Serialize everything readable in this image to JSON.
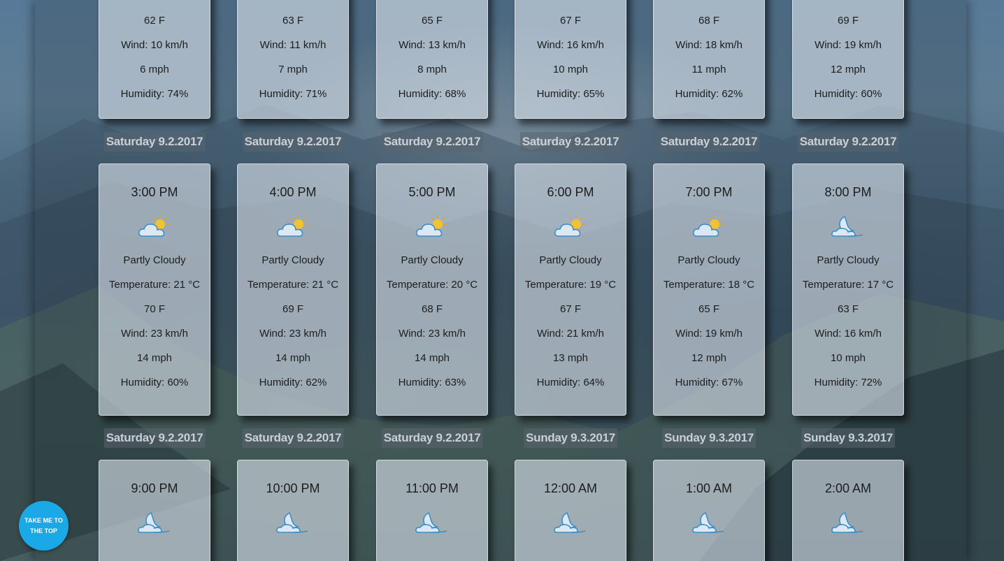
{
  "back_to_top": {
    "label": "TAKE ME TO THE TOP"
  },
  "rows": [
    {
      "cards": [
        {
          "temp_f": "62 F",
          "wind_kmh": "Wind: 10 km/h",
          "wind_mph": "6 mph",
          "humidity": "Humidity: 74%"
        },
        {
          "temp_f": "63 F",
          "wind_kmh": "Wind: 11 km/h",
          "wind_mph": "7 mph",
          "humidity": "Humidity: 71%"
        },
        {
          "temp_f": "65 F",
          "wind_kmh": "Wind: 13 km/h",
          "wind_mph": "8 mph",
          "humidity": "Humidity: 68%"
        },
        {
          "temp_f": "67 F",
          "wind_kmh": "Wind: 16 km/h",
          "wind_mph": "10 mph",
          "humidity": "Humidity: 65%"
        },
        {
          "temp_f": "68 F",
          "wind_kmh": "Wind: 18 km/h",
          "wind_mph": "11 mph",
          "humidity": "Humidity: 62%"
        },
        {
          "temp_f": "69 F",
          "wind_kmh": "Wind: 19 km/h",
          "wind_mph": "12 mph",
          "humidity": "Humidity: 60%"
        }
      ]
    },
    {
      "dates": [
        "Saturday 9.2.2017",
        "Saturday 9.2.2017",
        "Saturday 9.2.2017",
        "Saturday 9.2.2017",
        "Saturday 9.2.2017",
        "Saturday 9.2.2017"
      ],
      "cards": [
        {
          "time": "3:00 PM",
          "icon": "partly-cloudy-day-icon",
          "condition": "Partly Cloudy",
          "temp_c": "Temperature: 21 °C",
          "temp_f": "70 F",
          "wind_kmh": "Wind: 23 km/h",
          "wind_mph": "14 mph",
          "humidity": "Humidity: 60%"
        },
        {
          "time": "4:00 PM",
          "icon": "partly-cloudy-day-icon",
          "condition": "Partly Cloudy",
          "temp_c": "Temperature: 21 °C",
          "temp_f": "69 F",
          "wind_kmh": "Wind: 23 km/h",
          "wind_mph": "14 mph",
          "humidity": "Humidity: 62%"
        },
        {
          "time": "5:00 PM",
          "icon": "partly-cloudy-day-icon",
          "condition": "Partly Cloudy",
          "temp_c": "Temperature: 20 °C",
          "temp_f": "68 F",
          "wind_kmh": "Wind: 23 km/h",
          "wind_mph": "14 mph",
          "humidity": "Humidity: 63%"
        },
        {
          "time": "6:00 PM",
          "icon": "partly-cloudy-day-icon",
          "condition": "Partly Cloudy",
          "temp_c": "Temperature: 19 °C",
          "temp_f": "67 F",
          "wind_kmh": "Wind: 21 km/h",
          "wind_mph": "13 mph",
          "humidity": "Humidity: 64%"
        },
        {
          "time": "7:00 PM",
          "icon": "partly-cloudy-day-icon",
          "condition": "Partly Cloudy",
          "temp_c": "Temperature: 18 °C",
          "temp_f": "65 F",
          "wind_kmh": "Wind: 19 km/h",
          "wind_mph": "12 mph",
          "humidity": "Humidity: 67%"
        },
        {
          "time": "8:00 PM",
          "icon": "partly-cloudy-night-icon",
          "condition": "Partly Cloudy",
          "temp_c": "Temperature: 17 °C",
          "temp_f": "63 F",
          "wind_kmh": "Wind: 16 km/h",
          "wind_mph": "10 mph",
          "humidity": "Humidity: 72%"
        }
      ]
    },
    {
      "dates": [
        "Saturday 9.2.2017",
        "Saturday 9.2.2017",
        "Saturday 9.2.2017",
        "Sunday 9.3.2017",
        "Sunday 9.3.2017",
        "Sunday 9.3.2017"
      ],
      "cards": [
        {
          "time": "9:00 PM",
          "icon": "partly-cloudy-night-icon"
        },
        {
          "time": "10:00 PM",
          "icon": "partly-cloudy-night-icon"
        },
        {
          "time": "11:00 PM",
          "icon": "partly-cloudy-night-icon"
        },
        {
          "time": "12:00 AM",
          "icon": "partly-cloudy-night-icon"
        },
        {
          "time": "1:00 AM",
          "icon": "partly-cloudy-night-icon"
        },
        {
          "time": "2:00 AM",
          "icon": "partly-cloudy-night-icon"
        }
      ]
    }
  ]
}
